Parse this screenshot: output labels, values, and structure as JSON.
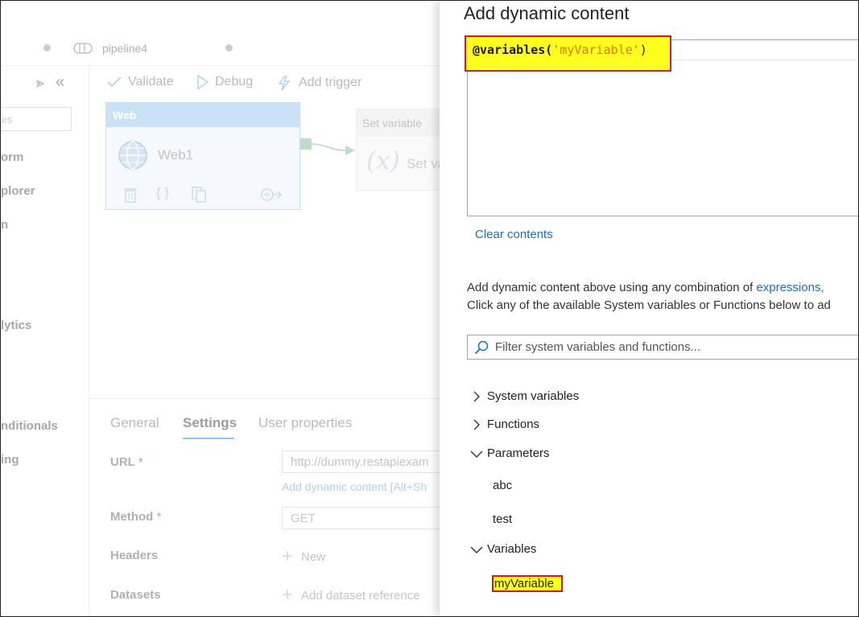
{
  "tabs": [
    {
      "label": "pipeline4"
    }
  ],
  "sidenav": {
    "search_placeholder": "es",
    "items": [
      "orm",
      "plorer",
      "n",
      "lytics",
      "nditionals",
      "ing"
    ]
  },
  "toolbar": {
    "validate": "Validate",
    "debug": "Debug",
    "add_trigger": "Add trigger"
  },
  "canvas": {
    "web_activity": {
      "header": "Web",
      "name": "Web1"
    },
    "set_variable": {
      "header": "Set variable",
      "name": "Set va"
    }
  },
  "properties": {
    "tabs": [
      "General",
      "Settings",
      "User properties"
    ],
    "active_tab": "Settings",
    "url_label": "URL",
    "url_value": "http://dummy.restapiexam",
    "url_link": "Add dynamic content [Alt+Sh",
    "method_label": "Method",
    "method_value": "GET",
    "headers_label": "Headers",
    "headers_new": "New",
    "datasets_label": "Datasets",
    "datasets_add": "Add dataset reference",
    "required_mark": "*"
  },
  "dynamic_content": {
    "title": "Add dynamic content",
    "expression": {
      "prefix": "@variables(",
      "argument": "'myVariable'",
      "suffix": ")"
    },
    "clear_contents": "Clear contents",
    "help_line1_text": "Add dynamic content above using any combination of ",
    "help_line1_link": "expressions,",
    "help_line2": "Click any of the available System variables or Functions below to ad",
    "filter_placeholder": "Filter system variables and functions...",
    "sections": {
      "system_variables": "System variables",
      "functions": "Functions",
      "parameters": "Parameters",
      "variables": "Variables"
    },
    "parameters": [
      "abc",
      "test"
    ],
    "variables": [
      "myVariable"
    ]
  },
  "colors": {
    "highlight_fill": "#ffff1e",
    "highlight_border": "#d01c1c",
    "link": "#1b6fb8",
    "string_literal": "#e07a00"
  }
}
